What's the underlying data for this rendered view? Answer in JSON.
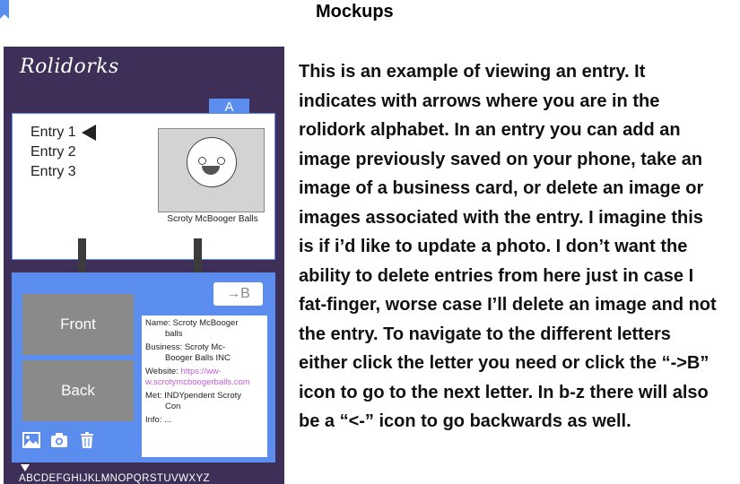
{
  "page_title": "Mockups",
  "app": {
    "name": "Rolidorks",
    "current_letter": "A",
    "entries": [
      "Entry 1",
      "Entry 2",
      "Entry 3"
    ],
    "photo_caption": "Scroty McBooger Balls",
    "next_letter_label": "→B",
    "front_label": "Front",
    "back_label": "Back",
    "details": {
      "name_line1": "Name: Scroty McBooger",
      "name_line2": "balls",
      "business_line1": "Business: Scroty Mc-",
      "business_line2": "Booger Balls INC",
      "website_label": "Website:",
      "website_url_line1": "https://ww-",
      "website_url_line2": "w.scrotymcboogerballs.com",
      "met_line1": "Met: INDYpendent Scroty",
      "met_line2": "Con",
      "info": "Info: ..."
    },
    "alphabet": "ABCDEFGHIJKLMNOPQRSTUVWXYZ",
    "icons": [
      "image-icon",
      "camera-icon",
      "trash-icon"
    ]
  },
  "description": "This is an example of viewing an entry. It indicates with arrows where you are in the rolidork alphabet. In an entry you can add an image previously saved on your phone, take an image of a business card, or delete an image or images associated with the entry. I imagine this is if i’d like to update a photo. I don’t want the ability to delete entries from here just in case I fat-finger, worse case I’ll delete an image and not the entry. To navigate to the different letters either click the letter you need or click the “->B” icon to go to the next letter. In b-z there will also be a “<-” icon to go backwards as well.",
  "colors": {
    "phone_bg": "#3d2f57",
    "accent_blue": "#5b8def",
    "card_gray": "#8a8a8a",
    "link_purple": "#c05bd6"
  }
}
